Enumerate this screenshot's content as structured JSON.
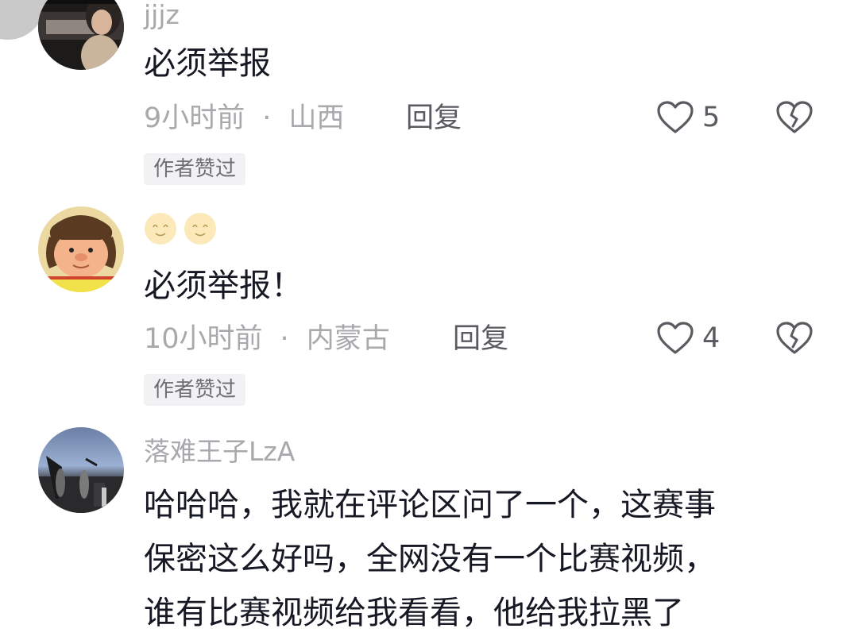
{
  "comments": [
    {
      "username": "jjjz",
      "text": "必须举报",
      "time": "9小时前",
      "location": "山西",
      "reply_label": "回复",
      "likes": "5",
      "badge": "作者赞过"
    },
    {
      "username_icons": [
        "smiley-face-icon",
        "smiley-face-icon"
      ],
      "text": "必须举报！",
      "time": "10小时前",
      "location": "内蒙古",
      "reply_label": "回复",
      "likes": "4",
      "badge": "作者赞过"
    },
    {
      "username": "落难王子LzA",
      "text_lines": [
        "哈哈哈，我就在评论区问了一个，这赛事",
        "保密这么好吗，全网没有一个比赛视频，",
        "谁有比赛视频给我看看，他给我拉黑了"
      ]
    }
  ],
  "meta_separator": "·",
  "colors": {
    "secondary_text": "#a9a9ad",
    "primary_text": "#161823",
    "badge_bg": "#f2f2f4"
  }
}
